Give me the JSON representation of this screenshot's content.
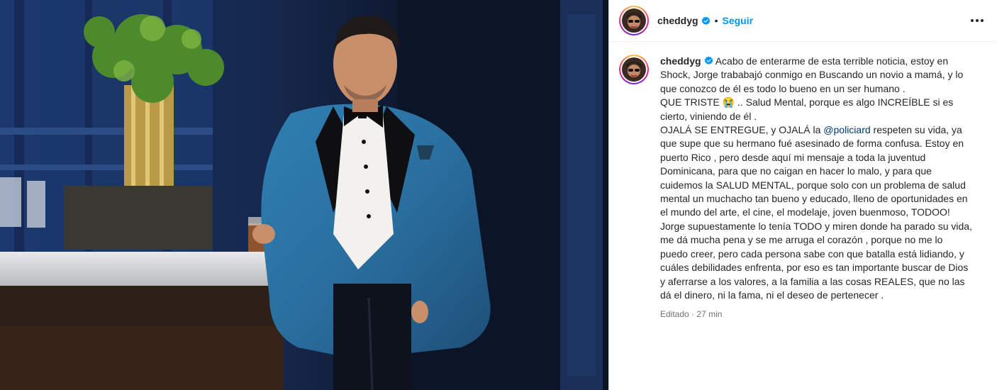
{
  "post": {
    "username": "cheddyg",
    "follow_label": "Seguir",
    "separator": "•",
    "caption": {
      "part1": " Acabo de enterarme de esta terrible noticia, estoy en Shock, Jorge trababajó conmigo en Buscando un novio a mamá, y lo que conozco de él es todo lo bueno en un ser humano .\nQUE TRISTE ",
      "emoji": "😭",
      "part2": " .. Salud Mental, porque es algo INCREÍBLE si es cierto, viniendo de él .\nOJALÁ SE ENTREGUE, y OJALÁ la ",
      "mention": "@policiard",
      "part3": " respeten su vida, ya que supe que su hermano fué asesinado de forma confusa. Estoy en puerto Rico , pero desde aquí mi mensaje a toda la juventud Dominicana, para que no caigan en hacer lo malo, y para que cuidemos la SALUD MENTAL, porque solo con un problema de salud mental un muchacho tan bueno y educado, lleno de oportunidades en el mundo del arte, el cine, el modelaje, joven buenmoso, TODOO!\nJorge supuestamente lo tenía TODO y miren donde ha parado su vida, me dá mucha pena y se me arruga el corazón , porque no me lo puedo creer, pero cada persona sabe con que batalla está lidiando, y cuáles debilidades enfrenta, por eso es tan importante buscar de Dios y aferrarse a los valores, a la familia a las cosas REALES, que no las dá el dinero, ni la fama, ni el deseo de pertenecer ."
    },
    "edited_label": "Editado",
    "time_label": "27 min"
  },
  "icons": {
    "verified": "verified-badge-icon",
    "more": "more-options-icon"
  },
  "colors": {
    "accent": "#0095f6",
    "verified": "#0095f6",
    "mention": "#00376b",
    "muted": "#737373"
  }
}
